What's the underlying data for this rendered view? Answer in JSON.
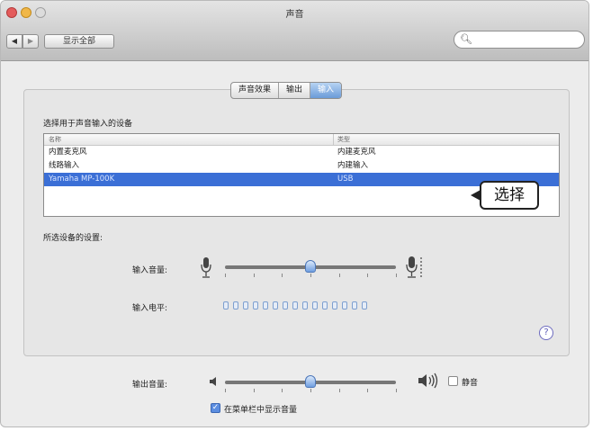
{
  "window": {
    "title": "声音"
  },
  "toolbar": {
    "back_glyph": "◀",
    "forward_glyph": "▶",
    "show_all_label": "显示全部",
    "search_placeholder": ""
  },
  "tabs": [
    {
      "label": "声音效果",
      "selected": false
    },
    {
      "label": "输出",
      "selected": false
    },
    {
      "label": "输入",
      "selected": true
    }
  ],
  "device_list": {
    "heading": "选择用于声音输入的设备",
    "columns": [
      "名称",
      "类型"
    ],
    "rows": [
      {
        "name": "内置麦克风",
        "type": "内建麦克风",
        "selected": false
      },
      {
        "name": "线路输入",
        "type": "内建输入",
        "selected": false
      },
      {
        "name": "Yamaha MP-100K",
        "type": "USB",
        "selected": true
      }
    ]
  },
  "callout": {
    "text": "选择"
  },
  "settings": {
    "heading": "所选设备的设置:",
    "input_volume_label": "输入音量:",
    "input_volume_value": 0.5,
    "input_level_label": "输入电平:",
    "input_level_segments": 15
  },
  "help_glyph": "?",
  "output": {
    "volume_label": "输出音量:",
    "volume_value": 0.5,
    "mute_label": "静音",
    "mute_checked": false,
    "menubar_checkbox_label": "在菜单栏中显示音量",
    "menubar_checkbox_checked": true
  },
  "colors": {
    "selection": "#3b6fd6",
    "tab_active": "#6b9bd8",
    "knob": "#6f9ee0"
  }
}
